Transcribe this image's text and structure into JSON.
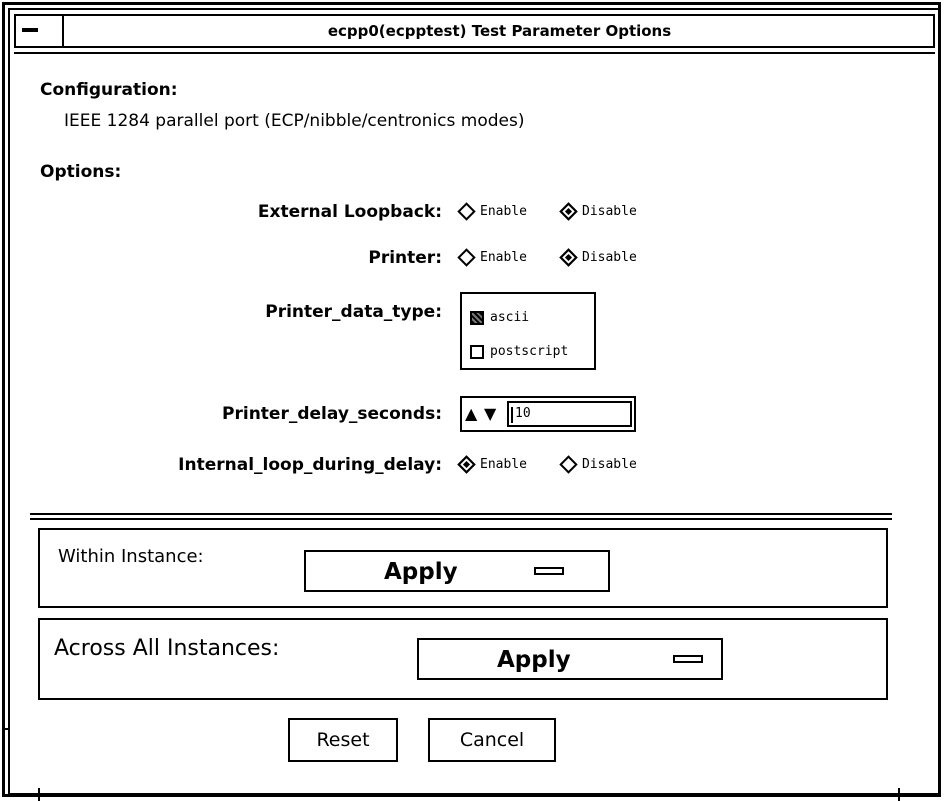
{
  "window": {
    "title": "ecpp0(ecpptest) Test Parameter Options"
  },
  "configuration": {
    "label": "Configuration:",
    "description": "IEEE 1284 parallel port (ECP/nibble/centronics modes)"
  },
  "options": {
    "label": "Options:",
    "external_loopback": {
      "label": "External Loopback:",
      "enable": "Enable",
      "disable": "Disable",
      "selected": "Disable"
    },
    "printer": {
      "label": "Printer:",
      "enable": "Enable",
      "disable": "Disable",
      "selected": "Disable"
    },
    "printer_data_type": {
      "label": "Printer_data_type:",
      "choices": [
        "ascii",
        "postscript"
      ],
      "selected": "ascii"
    },
    "printer_delay_seconds": {
      "label": "Printer_delay_seconds:",
      "value": "10",
      "arrows": "▲▼"
    },
    "internal_loop_during_delay": {
      "label": "Internal_loop_during_delay:",
      "enable": "Enable",
      "disable": "Disable",
      "selected": "Enable"
    }
  },
  "within_instance": {
    "label": "Within Instance:",
    "button": "Apply"
  },
  "across_all_instances": {
    "label": "Across All Instances:",
    "button": "Apply"
  },
  "buttons": {
    "reset": "Reset",
    "cancel": "Cancel"
  }
}
